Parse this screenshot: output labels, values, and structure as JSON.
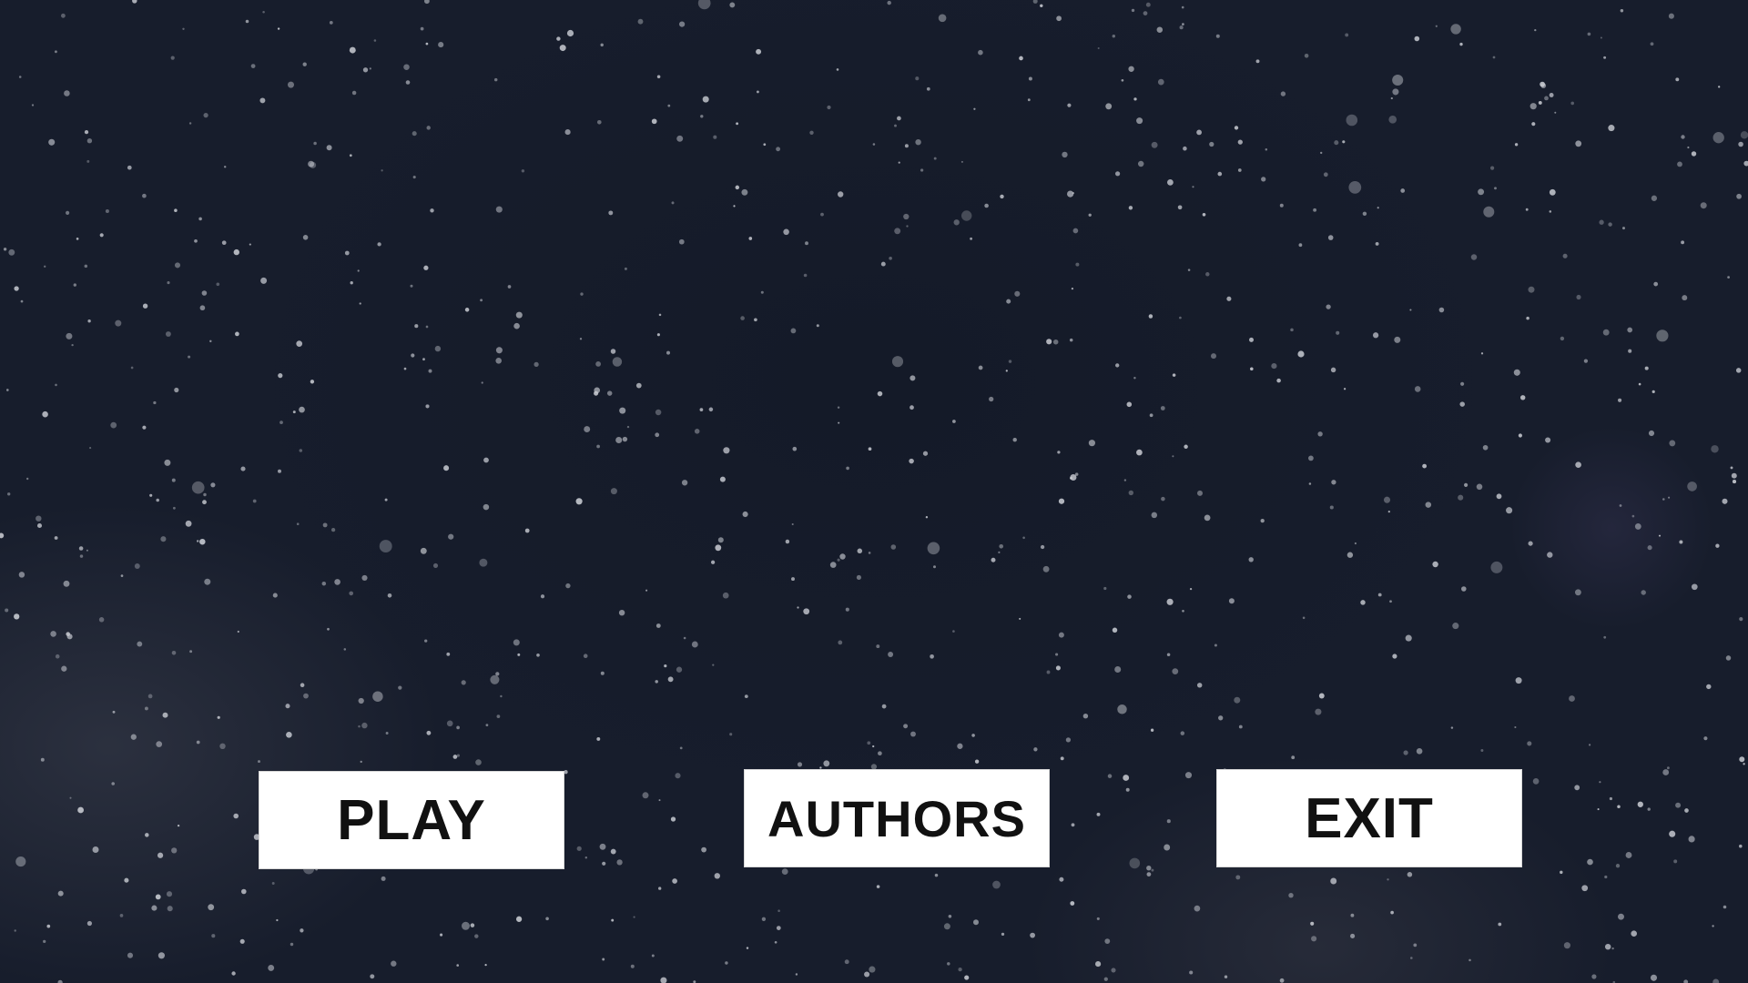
{
  "menu": {
    "play_label": "PLAY",
    "authors_label": "AUTHORS",
    "exit_label": "EXIT"
  },
  "theme": {
    "background": "#161c2b",
    "star_color": "#c8cbd2",
    "button_background": "#ffffff",
    "button_text": "#111111"
  }
}
